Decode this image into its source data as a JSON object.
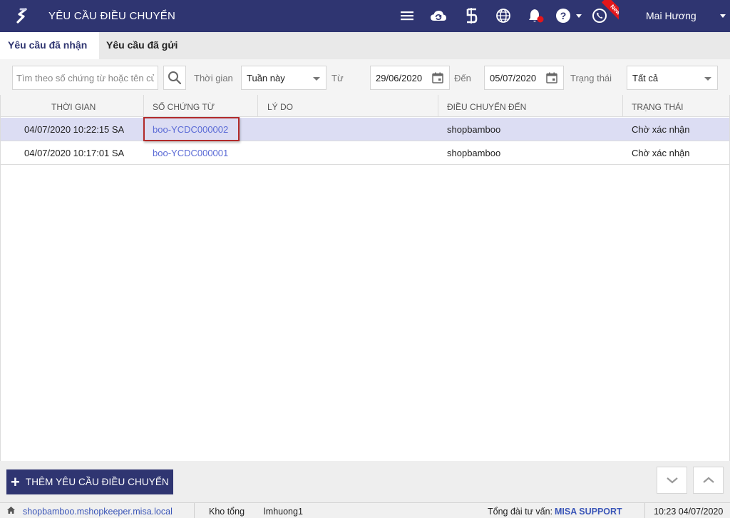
{
  "header": {
    "title": "YÊU CẦU ĐIỀU CHUYỂN",
    "user_name": "Mai Hương",
    "new_badge": "New",
    "icons": [
      "menu-icon",
      "cloud-sync-icon",
      "dollar-sign-icon",
      "globe-icon",
      "notification-bell-icon",
      "help-icon",
      "phone-support-icon"
    ],
    "accent_color": "#2f3571"
  },
  "tabs": [
    {
      "label": "Yêu cầu đã nhận",
      "active": true
    },
    {
      "label": "Yêu cầu đã gửi",
      "active": false
    }
  ],
  "filters": {
    "search_placeholder": "Tìm theo số chứng từ hoặc tên cửa hàng",
    "time_label": "Thời gian",
    "time_value": "Tuần này",
    "from_label": "Từ",
    "from_value": "29/06/2020",
    "to_label": "Đến",
    "to_value": "05/07/2020",
    "status_label": "Trạng thái",
    "status_value": "Tất cả"
  },
  "table": {
    "columns": [
      "THỜI GIAN",
      "SỐ CHỨNG TỪ",
      "LÝ DO",
      "ĐIỀU CHUYỂN ĐẾN",
      "TRẠNG THÁI"
    ],
    "rows": [
      {
        "time": "04/07/2020 10:22:15 SA",
        "doc_no": "boo-YCDC000002",
        "reason": "",
        "to_store": "shopbamboo",
        "status": "Chờ xác nhận",
        "selected": true
      },
      {
        "time": "04/07/2020 10:17:01 SA",
        "doc_no": "boo-YCDC000001",
        "reason": "",
        "to_store": "shopbamboo",
        "status": "Chờ xác nhận",
        "selected": false
      }
    ],
    "link_color": "#5b6bd6",
    "selected_row_color": "#dcddf3"
  },
  "actions": {
    "add_label": "THÊM YÊU CẦU ĐIỀU CHUYỂN",
    "add_icon": "plus-icon",
    "down_icon": "chevron-down-icon",
    "up_icon": "chevron-up-icon"
  },
  "statusbar": {
    "domain": "shopbamboo.mshopkeeper.misa.local",
    "warehouse": "Kho tổng",
    "username": "lmhuong1",
    "hotline_label": "Tổng đài tư vấn:",
    "hotline_value": "MISA SUPPORT",
    "datetime": "10:23 04/07/2020"
  }
}
